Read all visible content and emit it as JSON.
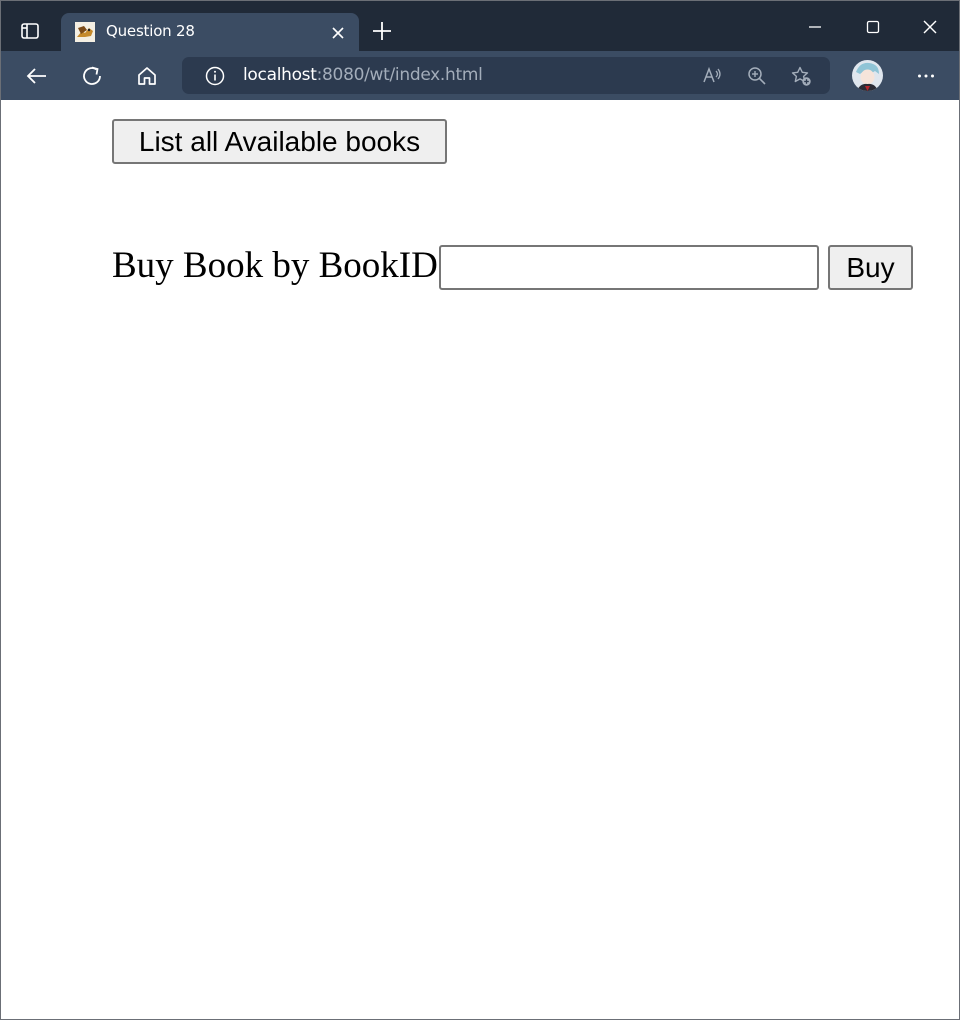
{
  "browser": {
    "tab": {
      "title": "Question 28",
      "favicon": "tomcat-favicon-icon"
    },
    "address_bar": {
      "url_host": "localhost",
      "url_rest": ":8080/wt/index.html"
    },
    "icons": {
      "tab_actions": "tab-actions-icon",
      "close_tab": "close-icon",
      "new_tab": "plus-icon",
      "minimize": "minimize-icon",
      "maximize": "maximize-icon",
      "close_window": "close-icon",
      "back": "back-arrow-icon",
      "refresh": "refresh-icon",
      "home": "home-icon",
      "site_info": "info-icon",
      "read_aloud": "read-aloud-icon",
      "zoom": "zoom-in-icon",
      "favorites": "add-favorite-icon",
      "more": "more-icon"
    },
    "colors": {
      "tabstrip": "#202a38",
      "toolbar": "#3b4c63",
      "address_bg": "#2c3a4f"
    }
  },
  "page": {
    "list_button_label": "List all Available books",
    "buy_label": "Buy Book by BookID:",
    "bookid_value": "",
    "buy_button_label": "Buy"
  }
}
